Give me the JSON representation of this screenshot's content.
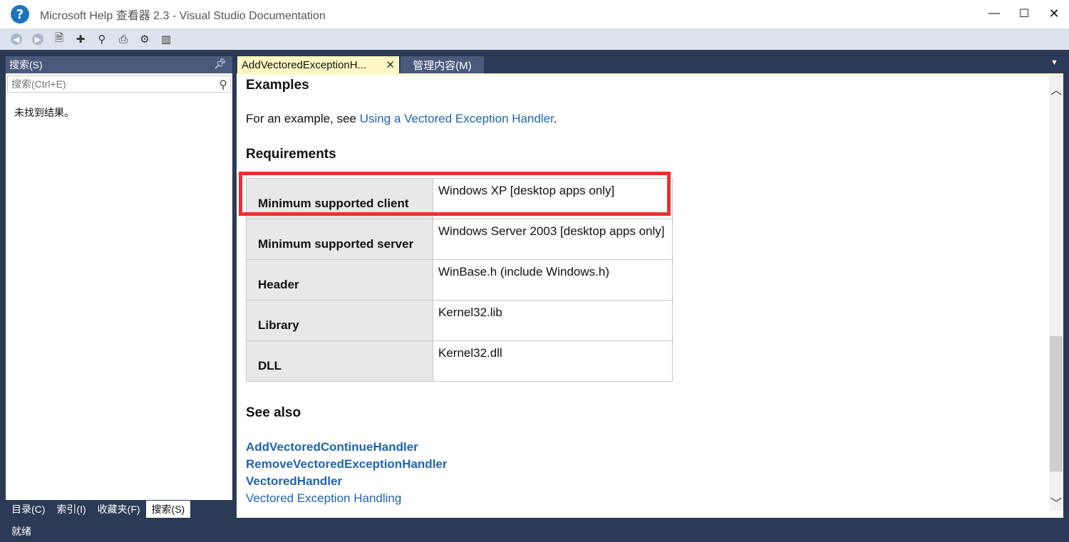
{
  "window": {
    "title": "Microsoft Help 查看器 2.3 - Visual Studio Documentation",
    "minimize": "—",
    "maximize": "☐",
    "close": "✕"
  },
  "toolbar": {
    "icons": [
      "back-icon",
      "forward-icon",
      "open-icon",
      "add-favorite-icon",
      "search-icon",
      "print-icon",
      "settings-icon",
      "library-icon"
    ]
  },
  "left_panel": {
    "header": "搜索(S)",
    "search_placeholder": "搜索(Ctrl+E)",
    "search_value": "",
    "no_results": "未找到结果。",
    "tabs": [
      {
        "label": "目录(C)"
      },
      {
        "label": "索引(I)"
      },
      {
        "label": "收藏夹(F)"
      },
      {
        "label": "搜索(S)"
      }
    ]
  },
  "doc_tabs": [
    {
      "label": "AddVectoredExceptionH..."
    },
    {
      "label": "管理内容(M)"
    }
  ],
  "content": {
    "examples_heading": "Examples",
    "example_prefix": "For an example, see ",
    "example_link": "Using a Vectored Exception Handler",
    "example_suffix": ".",
    "requirements_heading": "Requirements",
    "requirements": [
      {
        "key": "Minimum supported client",
        "value": "Windows XP [desktop apps only]"
      },
      {
        "key": "Minimum supported server",
        "value": "Windows Server 2003 [desktop apps only]"
      },
      {
        "key": "Header",
        "value": "WinBase.h (include Windows.h)"
      },
      {
        "key": "Library",
        "value": "Kernel32.lib"
      },
      {
        "key": "DLL",
        "value": "Kernel32.dll"
      }
    ],
    "see_also_heading": "See also",
    "see_also": [
      {
        "label": "AddVectoredContinueHandler",
        "bold": true
      },
      {
        "label": "RemoveVectoredExceptionHandler",
        "bold": true
      },
      {
        "label": "VectoredHandler",
        "bold": true
      },
      {
        "label": "Vectored Exception Handling",
        "bold": false
      }
    ]
  },
  "status": "就绪",
  "colors": {
    "highlight_border": "#e8322f",
    "link": "#1e64b4",
    "active_tab": "#fff8c4",
    "chrome": "#2b3a55"
  }
}
